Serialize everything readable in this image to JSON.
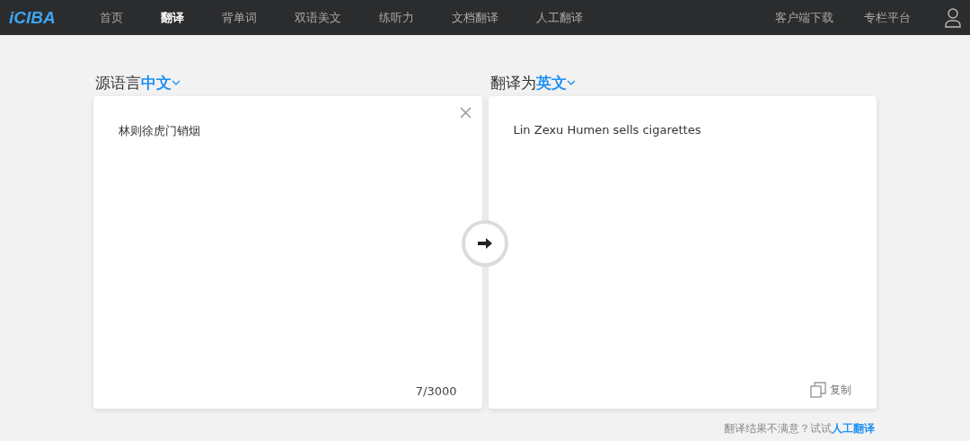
{
  "nav": {
    "logo": "iCIBA",
    "items": [
      {
        "label": "首页",
        "selected": false
      },
      {
        "label": "翻译",
        "selected": true
      },
      {
        "label": "背单词",
        "selected": false
      },
      {
        "label": "双语美文",
        "selected": false
      },
      {
        "label": "练听力",
        "selected": false
      },
      {
        "label": "文档翻译",
        "selected": false
      },
      {
        "label": "人工翻译",
        "selected": false
      }
    ],
    "right_links": [
      "客户端下载",
      "专栏平台"
    ]
  },
  "source": {
    "label": "源语言",
    "language": "中文",
    "text": "林则徐虎门销烟",
    "counter": "7/3000"
  },
  "target": {
    "label": "翻译为",
    "language": "英文",
    "text": "Lin Zexu Humen sells cigarettes",
    "copy": "复制"
  },
  "footer": {
    "question": "翻译结果不满意？试试",
    "link": "人工翻译"
  }
}
